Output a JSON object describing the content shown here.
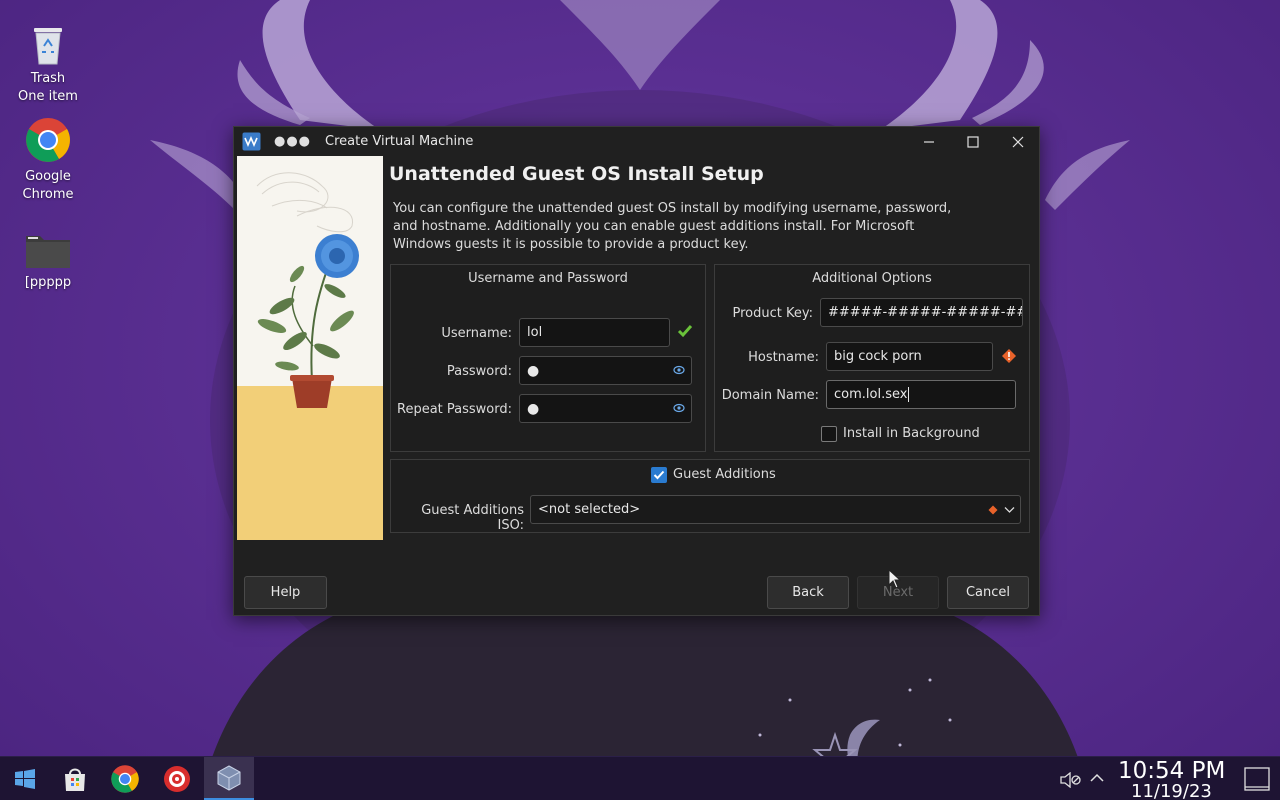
{
  "desktop": {
    "icons": [
      {
        "label": "Trash",
        "sublabel": "One item"
      },
      {
        "label": "Google",
        "sublabel": "Chrome"
      },
      {
        "label": "[ppppp"
      }
    ]
  },
  "window": {
    "title": "Create Virtual Machine",
    "heading": "Unattended Guest OS Install Setup",
    "description": "You can configure the unattended guest OS install by modifying username, password, and hostname. Additionally you can enable guest additions install. For Microsoft Windows guests it is possible to provide a product key.",
    "username_group": {
      "title": "Username and Password",
      "username_label": "Username:",
      "username_value": "lol",
      "password_label": "Password:",
      "password_value": "●",
      "repeat_label": "Repeat Password:",
      "repeat_value": "●"
    },
    "additional_group": {
      "title": "Additional Options",
      "product_key_label": "Product Key:",
      "product_key_value": "#####-#####-#####-#####-#",
      "hostname_label": "Hostname:",
      "hostname_value": "big cock porn",
      "domain_label": "Domain Name:",
      "domain_value": "com.lol.sex",
      "install_background_label": "Install in Background",
      "install_background_checked": false
    },
    "guest_additions": {
      "label": "Guest Additions",
      "checked": true,
      "iso_label": "Guest Additions ISO:",
      "iso_value": "<not selected>"
    },
    "buttons": {
      "help": "Help",
      "back": "Back",
      "next": "Next",
      "cancel": "Cancel"
    }
  },
  "taskbar": {
    "time": "10:54 PM",
    "date": "11/19/23"
  },
  "colors": {
    "accent": "#2a7bd0",
    "valid": "#6ac23a",
    "warning": "#e8622a",
    "wallpaper": "#5a2f92"
  }
}
